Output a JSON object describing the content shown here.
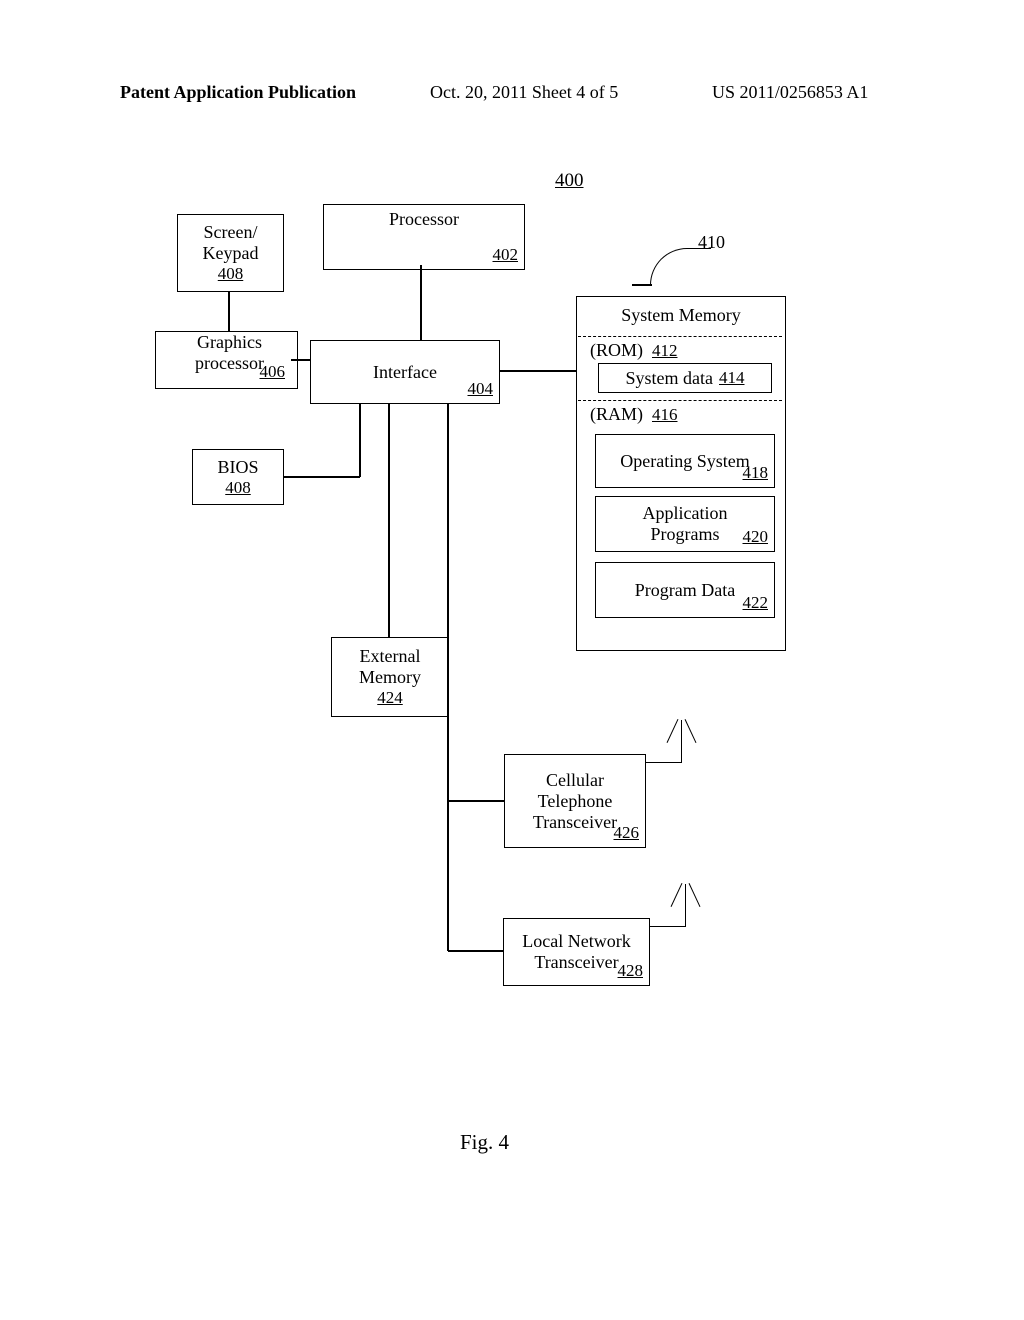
{
  "header": {
    "left": "Patent Application Publication",
    "center": "Oct. 20, 2011  Sheet 4 of 5",
    "right": "US 2011/0256853 A1"
  },
  "figure_number": "400",
  "figcaption": "Fig. 4",
  "callout_410": "410",
  "boxes": {
    "screen_keypad": {
      "title": "Screen/\nKeypad",
      "ref": "408"
    },
    "processor": {
      "title": "Processor",
      "ref": "402"
    },
    "graphics": {
      "title": "Graphics\nprocessor",
      "ref": "406"
    },
    "interface": {
      "title": "Interface",
      "ref": "404"
    },
    "bios": {
      "title": "BIOS",
      "ref": "408"
    },
    "ext_memory": {
      "title": "External\nMemory",
      "ref": "424"
    },
    "cell_xcvr": {
      "title": "Cellular\nTelephone\nTransceiver",
      "ref": "426"
    },
    "local_xcvr": {
      "title": "Local Network\nTransceiver",
      "ref": "428"
    },
    "sysmem": {
      "title": "System Memory"
    },
    "rom": {
      "label": "(ROM)",
      "ref": "412"
    },
    "sysdata": {
      "title": "System data",
      "ref": "414"
    },
    "ram": {
      "label": "(RAM)",
      "ref": "416"
    },
    "os": {
      "title": "Operating System",
      "ref": "418"
    },
    "appprogs": {
      "title": "Application\nPrograms",
      "ref": "420"
    },
    "progdata": {
      "title": "Program Data",
      "ref": "422"
    }
  }
}
